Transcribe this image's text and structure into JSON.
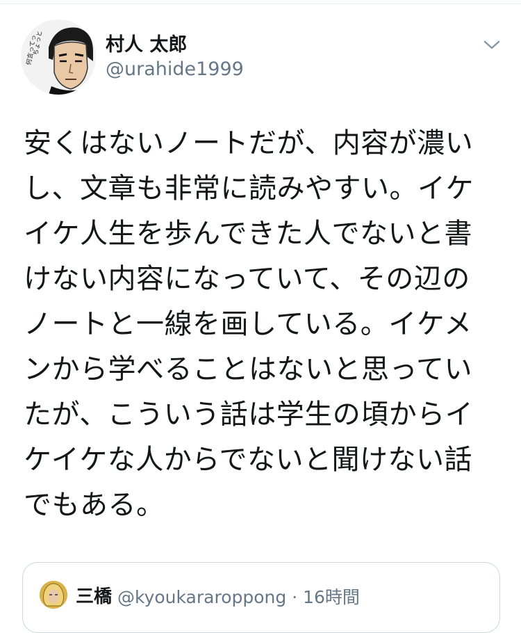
{
  "tweet": {
    "author": {
      "display_name": "村人 太郎",
      "handle": "@urahide1999",
      "avatar_caption": "ちょっと 何言ってっ"
    },
    "menu_icon": "chevron-down-icon",
    "body_lines": [
      "安くはないノートだが、内容が濃い",
      "し、文章も非常に読みやすい。イケ",
      "イケ人生を歩んできた人でないと書",
      "けない内容になっていて、その辺の",
      "ノートと一線を画している。イケメ",
      "ンから学べることはないと思ってい",
      "たが、こういう話は学生の頃からイ",
      "ケイケな人からでないと聞けない話",
      "でもある。"
    ]
  },
  "quoted_tweet": {
    "display_name": "三橋",
    "handle_time": "@kyoukararoppong · 16時間"
  },
  "colors": {
    "text_primary": "#14171a",
    "text_secondary": "#657786",
    "border": "#ccd6dd"
  }
}
